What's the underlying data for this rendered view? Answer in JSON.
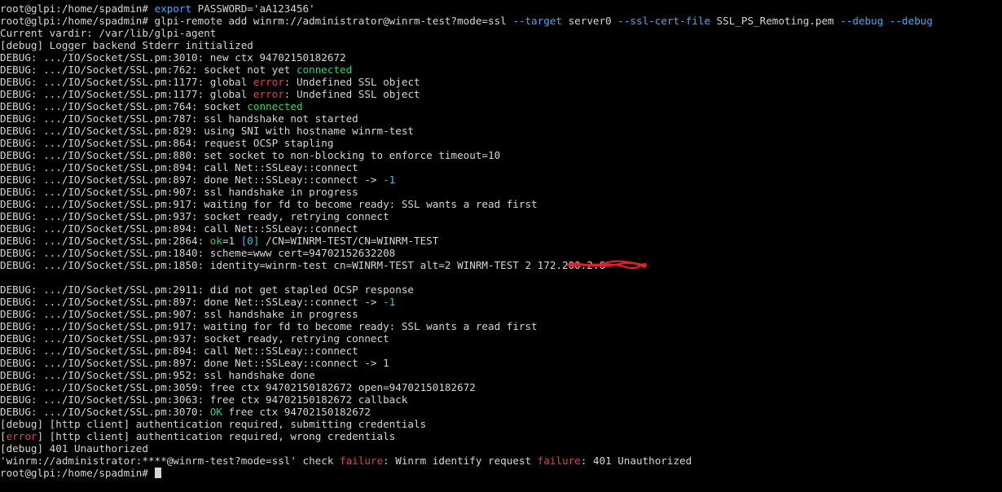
{
  "terminal": {
    "lines": [
      [
        {
          "t": "root@glpi:/home/spadmin# ",
          "c": "white"
        },
        {
          "t": "export",
          "c": "blue"
        },
        {
          "t": " PASSWORD='aA123456'",
          "c": "white"
        }
      ],
      [
        {
          "t": "root@glpi:/home/spadmin# glpi-remote add winrm://administrator@winrm-test?mode=ssl ",
          "c": "white"
        },
        {
          "t": "--target",
          "c": "blue"
        },
        {
          "t": " server0 ",
          "c": "white"
        },
        {
          "t": "--ssl-cert-file",
          "c": "blue"
        },
        {
          "t": " SSL_PS_Remoting.pem ",
          "c": "white"
        },
        {
          "t": "--debug --debug",
          "c": "blue"
        }
      ],
      [
        {
          "t": "Current vardir: /var/lib/glpi-agent",
          "c": "white"
        }
      ],
      [
        {
          "t": "[debug] Logger backend Stderr initialized",
          "c": "white"
        }
      ],
      [
        {
          "t": "DEBUG: .../IO/Socket/SSL.pm:3010: new ctx 94702150182672",
          "c": "white"
        }
      ],
      [
        {
          "t": "DEBUG: .../IO/Socket/SSL.pm:762: socket not yet ",
          "c": "white"
        },
        {
          "t": "connected",
          "c": "green"
        }
      ],
      [
        {
          "t": "DEBUG: .../IO/Socket/SSL.pm:1177: global ",
          "c": "white"
        },
        {
          "t": "error",
          "c": "red"
        },
        {
          "t": ": Undefined SSL object",
          "c": "white"
        }
      ],
      [
        {
          "t": "DEBUG: .../IO/Socket/SSL.pm:1177: global ",
          "c": "white"
        },
        {
          "t": "error",
          "c": "red"
        },
        {
          "t": ": Undefined SSL object",
          "c": "white"
        }
      ],
      [
        {
          "t": "DEBUG: .../IO/Socket/SSL.pm:764: socket ",
          "c": "white"
        },
        {
          "t": "connected",
          "c": "green"
        }
      ],
      [
        {
          "t": "DEBUG: .../IO/Socket/SSL.pm:787: ssl handshake not started",
          "c": "white"
        }
      ],
      [
        {
          "t": "DEBUG: .../IO/Socket/SSL.pm:829: using SNI with hostname winrm-test",
          "c": "white"
        }
      ],
      [
        {
          "t": "DEBUG: .../IO/Socket/SSL.pm:864: request OCSP stapling",
          "c": "white"
        }
      ],
      [
        {
          "t": "DEBUG: .../IO/Socket/SSL.pm:880: set socket to non-blocking to enforce timeout=10",
          "c": "white"
        }
      ],
      [
        {
          "t": "DEBUG: .../IO/Socket/SSL.pm:894: call Net::SSLeay::connect",
          "c": "white"
        }
      ],
      [
        {
          "t": "DEBUG: .../IO/Socket/SSL.pm:897: done Net::SSLeay::connect -> ",
          "c": "white"
        },
        {
          "t": "-1",
          "c": "cyan"
        }
      ],
      [
        {
          "t": "DEBUG: .../IO/Socket/SSL.pm:907: ssl handshake in progress",
          "c": "white"
        }
      ],
      [
        {
          "t": "DEBUG: .../IO/Socket/SSL.pm:917: waiting for fd to become ready: SSL wants a read first",
          "c": "white"
        }
      ],
      [
        {
          "t": "DEBUG: .../IO/Socket/SSL.pm:937: socket ready, retrying connect",
          "c": "white"
        }
      ],
      [
        {
          "t": "DEBUG: .../IO/Socket/SSL.pm:894: call Net::SSLeay::connect",
          "c": "white"
        }
      ],
      [
        {
          "t": "DEBUG: .../IO/Socket/SSL.pm:2864: ",
          "c": "white"
        },
        {
          "t": "ok",
          "c": "green"
        },
        {
          "t": "=1 ",
          "c": "white"
        },
        {
          "t": "[0]",
          "c": "cyan"
        },
        {
          "t": " /CN=WINRM-TEST/CN=WINRM-TEST",
          "c": "white"
        }
      ],
      [
        {
          "t": "DEBUG: .../IO/Socket/SSL.pm:1840: scheme=www cert=94702152632208",
          "c": "white"
        }
      ],
      [
        {
          "t": "DEBUG: .../IO/Socket/SSL.pm:1850: identity=winrm-test cn=WINRM-TEST alt=2 WINRM-TEST 2 ",
          "c": "white"
        },
        {
          "t": "172.200.2.6",
          "c": "white"
        }
      ],
      [
        {
          "t": "",
          "c": "white"
        }
      ],
      [
        {
          "t": "DEBUG: .../IO/Socket/SSL.pm:2911: did not get stapled OCSP response",
          "c": "white"
        }
      ],
      [
        {
          "t": "DEBUG: .../IO/Socket/SSL.pm:897: done Net::SSLeay::connect -> ",
          "c": "white"
        },
        {
          "t": "-1",
          "c": "cyan"
        }
      ],
      [
        {
          "t": "DEBUG: .../IO/Socket/SSL.pm:907: ssl handshake in progress",
          "c": "white"
        }
      ],
      [
        {
          "t": "DEBUG: .../IO/Socket/SSL.pm:917: waiting for fd to become ready: SSL wants a read first",
          "c": "white"
        }
      ],
      [
        {
          "t": "DEBUG: .../IO/Socket/SSL.pm:937: socket ready, retrying connect",
          "c": "white"
        }
      ],
      [
        {
          "t": "DEBUG: .../IO/Socket/SSL.pm:894: call Net::SSLeay::connect",
          "c": "white"
        }
      ],
      [
        {
          "t": "DEBUG: .../IO/Socket/SSL.pm:897: done Net::SSLeay::connect -> 1",
          "c": "white"
        }
      ],
      [
        {
          "t": "DEBUG: .../IO/Socket/SSL.pm:952: ssl handshake done",
          "c": "white"
        }
      ],
      [
        {
          "t": "DEBUG: .../IO/Socket/SSL.pm:3059: free ctx 94702150182672 open=94702150182672",
          "c": "white"
        }
      ],
      [
        {
          "t": "DEBUG: .../IO/Socket/SSL.pm:3063: free ctx 94702150182672 callback",
          "c": "white"
        }
      ],
      [
        {
          "t": "DEBUG: .../IO/Socket/SSL.pm:3070: ",
          "c": "white"
        },
        {
          "t": "OK",
          "c": "green"
        },
        {
          "t": " free ctx 94702150182672",
          "c": "white"
        }
      ],
      [
        {
          "t": "[debug] [http client] authentication required, submitting credentials",
          "c": "white"
        }
      ],
      [
        {
          "t": "[",
          "c": "white"
        },
        {
          "t": "error",
          "c": "red"
        },
        {
          "t": "] [http client] authentication required, wrong credentials",
          "c": "white"
        }
      ],
      [
        {
          "t": "[debug] 401 Unauthorized",
          "c": "white"
        }
      ],
      [
        {
          "t": "'winrm://administrator:****@winrm-test?mode=ssl' check ",
          "c": "white"
        },
        {
          "t": "failure",
          "c": "red"
        },
        {
          "t": ": Winrm identify request ",
          "c": "white"
        },
        {
          "t": "failure",
          "c": "red"
        },
        {
          "t": ": 401 Unauthorized",
          "c": "white"
        }
      ],
      [
        {
          "t": "root@glpi:/home/spadmin# ",
          "c": "white"
        }
      ]
    ],
    "colors": {
      "background": "#000000",
      "text": "#d6d6d6",
      "blue": "#4ea8f0",
      "green": "#2bd46c",
      "red": "#e0444c",
      "cyan": "#3fc6e6",
      "redaction": "#e0202a"
    }
  }
}
